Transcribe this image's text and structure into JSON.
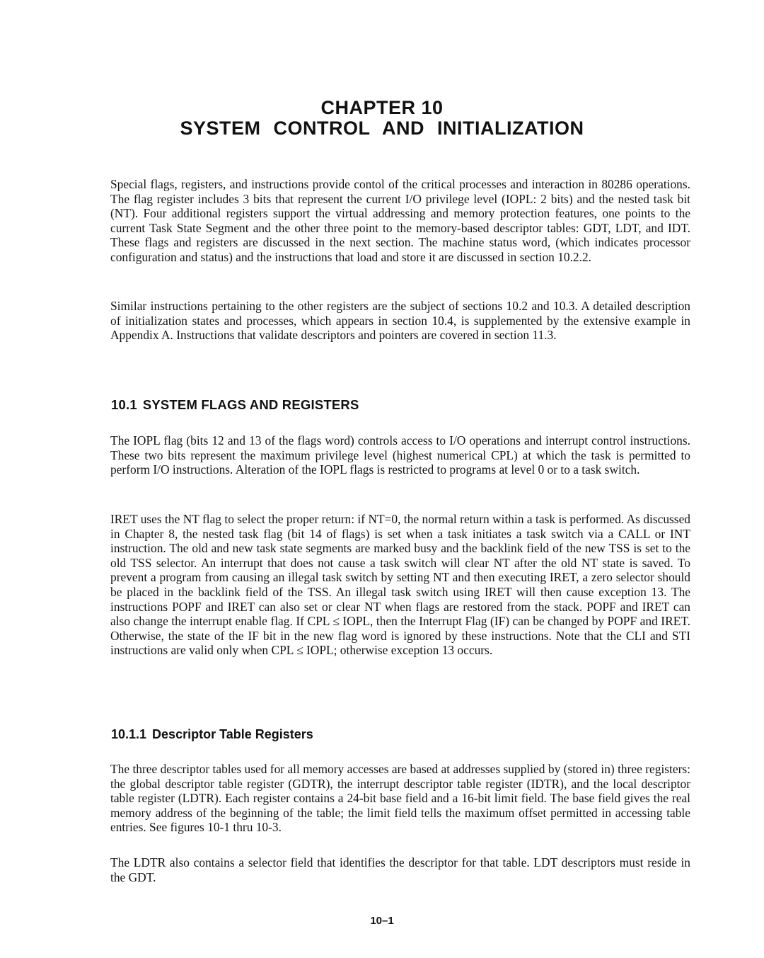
{
  "chapter": {
    "label": "CHAPTER 10",
    "title": "SYSTEM CONTROL AND INITIALIZATION"
  },
  "intro": {
    "paragraphs": [
      "Special flags, registers, and instructions provide contol of the critical processes and interaction in 80286 operations. The flag register includes 3 bits that represent the current I/O privilege level (IOPL: 2 bits) and the nested task bit (NT). Four additional registers support the virtual addressing and memory protection features, one points to the current Task State Segment and the other three point to the memory-based descriptor tables: GDT, LDT, and IDT. These flags and registers are discussed in the next section. The machine status word, (which indicates processor configuration and status) and the instructions that load and store it are discussed in section 10.2.2.",
      "Similar instructions pertaining to the other registers are the subject of sections 10.2 and 10.3. A detailed description of initialization states and processes, which appears in section 10.4, is supplemented by the extensive example in Appendix A. Instructions that validate descriptors and pointers are covered in section 11.3."
    ]
  },
  "section_10_1": {
    "number": "10.1",
    "title": "SYSTEM FLAGS AND REGISTERS",
    "paragraphs": [
      "The IOPL flag (bits 12 and 13 of the flags word) controls access to I/O operations and interrupt control instructions. These two bits represent the maximum privilege level (highest numerical CPL) at which the task is permitted to perform I/O instructions. Alteration of the IOPL flags is restricted to programs at level 0 or to a task switch.",
      "IRET uses the NT flag to select the proper return: if NT=0, the normal return within a task is performed. As discussed in Chapter 8, the nested task flag (bit 14 of flags) is set when a task initiates a task switch via a CALL or INT instruction. The old and new task state segments are marked busy and the backlink field of the new TSS is set to the old TSS selector. An interrupt that does not cause a task switch will clear NT after the old NT state is saved. To prevent a program from causing an illegal task switch by setting NT and then executing IRET, a zero selector should be placed in the backlink field of the TSS. An illegal task switch using IRET will then cause exception 13. The instruc­tions POPF and IRET can also set or clear NT when flags are restored from the stack. POPF and IRET can also change the interrupt enable flag. If CPL ≤ IOPL, then the Interrupt Flag (IF) can be changed by POPF and IRET. Otherwise, the state of the IF bit in the new flag word is ignored by these instructions. Note that the CLI and STI instructions are valid only when CPL ≤ IOPL; other­wise exception 13 occurs."
    ]
  },
  "section_10_1_1": {
    "number": "10.1.1",
    "title": "Descriptor Table Registers",
    "paragraphs": [
      "The three descriptor tables used for all memory accesses are based at addresses supplied by (stored in) three registers: the global descriptor table register (GDTR), the interrupt descriptor table register (IDTR), and the local descriptor table register (LDTR). Each register contains a 24-bit base field and a 16-bit limit field. The base field gives the real memory address of the beginning of the table; the limit field tells the maximum offset permitted in accessing table entries. See figures 10-1 thru 10-3.",
      "The LDTR also contains a selector field that identifies the descriptor for that table. LDT descriptors must reside in the GDT."
    ]
  },
  "footer": {
    "page_number": "10–1"
  }
}
